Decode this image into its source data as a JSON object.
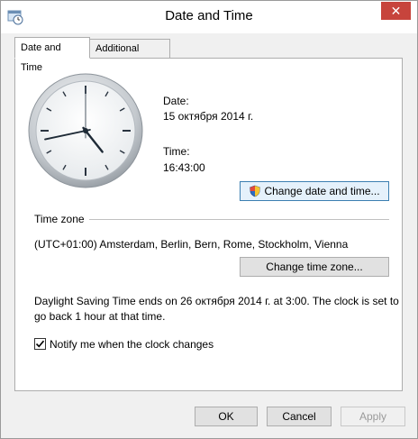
{
  "window": {
    "title": "Date and Time",
    "close_glyph": "✕"
  },
  "tabs": [
    {
      "label": "Date and Time",
      "active": true
    },
    {
      "label": "Additional Clocks",
      "active": false
    }
  ],
  "datetime": {
    "date_label": "Date:",
    "date_value": "15 октября 2014 г.",
    "time_label": "Time:",
    "time_value": "16:43:00",
    "change_button": "Change date and time..."
  },
  "clock": {
    "hour": 16,
    "minute": 43,
    "second": 0
  },
  "timezone": {
    "section_label": "Time zone",
    "value": "(UTC+01:00) Amsterdam, Berlin, Bern, Rome, Stockholm, Vienna",
    "change_button": "Change time zone..."
  },
  "dst": {
    "line1": "Daylight Saving Time ends on 26 октября 2014 г. at 3:00. The clock is set to",
    "line2": "go back 1 hour at that time."
  },
  "notify": {
    "label": "Notify me when the clock changes",
    "checked": true
  },
  "footer": {
    "ok": "OK",
    "cancel": "Cancel",
    "apply": "Apply"
  },
  "icons": {
    "app": "clock-window-icon",
    "uac": "uac-shield-icon",
    "check": "checkmark-icon"
  }
}
